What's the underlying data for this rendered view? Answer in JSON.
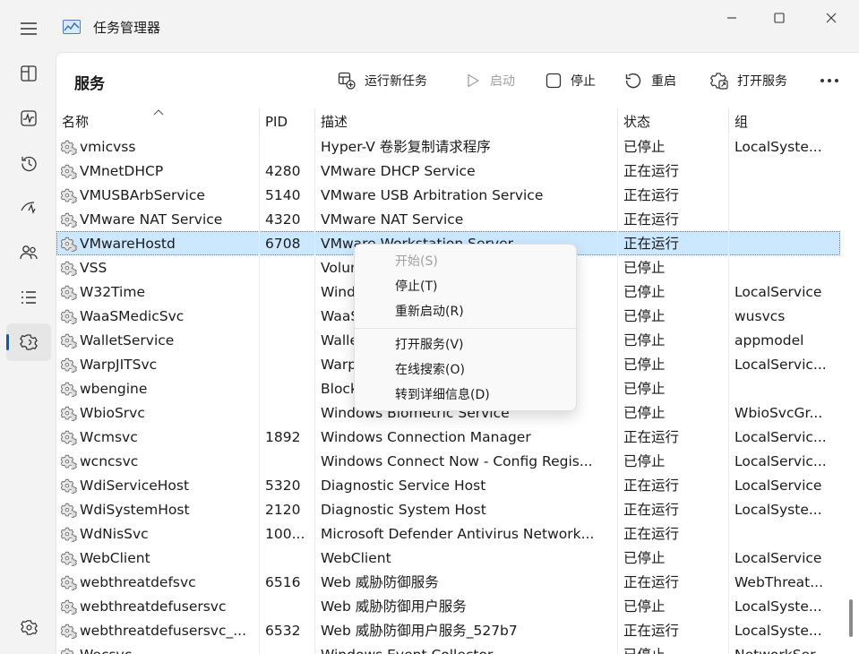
{
  "window": {
    "title": "任务管理器",
    "controls": [
      "minimize-icon",
      "maximize-icon",
      "close-icon"
    ]
  },
  "nav": {
    "items": [
      {
        "name": "processes",
        "icon": "processes-icon"
      },
      {
        "name": "performance",
        "icon": "performance-icon"
      },
      {
        "name": "app-history",
        "icon": "history-icon"
      },
      {
        "name": "startup-apps",
        "icon": "startup-icon"
      },
      {
        "name": "users",
        "icon": "users-icon"
      },
      {
        "name": "details",
        "icon": "details-icon"
      },
      {
        "name": "services",
        "icon": "services-icon",
        "active": true
      }
    ],
    "settings_icon": "gear-icon"
  },
  "page": {
    "title": "服务",
    "toolbar": {
      "run_new_task": "运行新任务",
      "start": "启动",
      "stop": "停止",
      "restart": "重启",
      "open_services": "打开服务",
      "more": "…"
    }
  },
  "table": {
    "headers": {
      "name": "名称",
      "pid": "PID",
      "desc": "描述",
      "status": "状态",
      "group": "组"
    },
    "sort_column": "name",
    "rows": [
      {
        "name": "vmicvss",
        "pid": "",
        "desc": "Hyper-V 卷影复制请求程序",
        "status": "已停止",
        "group": "LocalSyste..."
      },
      {
        "name": "VMnetDHCP",
        "pid": "4280",
        "desc": "VMware DHCP Service",
        "status": "正在运行",
        "group": ""
      },
      {
        "name": "VMUSBArbService",
        "pid": "5140",
        "desc": "VMware USB Arbitration Service",
        "status": "正在运行",
        "group": ""
      },
      {
        "name": "VMware NAT Service",
        "pid": "4320",
        "desc": "VMware NAT Service",
        "status": "正在运行",
        "group": ""
      },
      {
        "name": "VMwareHostd",
        "pid": "6708",
        "desc": "VMware Workstation Server",
        "status": "正在运行",
        "group": "",
        "selected": true
      },
      {
        "name": "VSS",
        "pid": "",
        "desc": "Volume Shadow Copy",
        "status": "已停止",
        "group": ""
      },
      {
        "name": "W32Time",
        "pid": "",
        "desc": "Windows Time",
        "status": "已停止",
        "group": "LocalService"
      },
      {
        "name": "WaaSMedicSvc",
        "pid": "",
        "desc": "WaaSMedicSvc",
        "status": "已停止",
        "group": "wusvcs"
      },
      {
        "name": "WalletService",
        "pid": "",
        "desc": "WalletService",
        "status": "已停止",
        "group": "appmodel"
      },
      {
        "name": "WarpJITSvc",
        "pid": "",
        "desc": "Warp JIT Service",
        "status": "已停止",
        "group": "LocalServic..."
      },
      {
        "name": "wbengine",
        "pid": "",
        "desc": "Block Level Backup Engine Service",
        "status": "已停止",
        "group": ""
      },
      {
        "name": "WbioSrvc",
        "pid": "",
        "desc": "Windows Biometric Service",
        "status": "已停止",
        "group": "WbioSvcGr..."
      },
      {
        "name": "Wcmsvc",
        "pid": "1892",
        "desc": "Windows Connection Manager",
        "status": "正在运行",
        "group": "LocalServic..."
      },
      {
        "name": "wcncsvc",
        "pid": "",
        "desc": "Windows Connect Now - Config Regis...",
        "status": "已停止",
        "group": "LocalServic..."
      },
      {
        "name": "WdiServiceHost",
        "pid": "5320",
        "desc": "Diagnostic Service Host",
        "status": "正在运行",
        "group": "LocalService"
      },
      {
        "name": "WdiSystemHost",
        "pid": "2120",
        "desc": "Diagnostic System Host",
        "status": "正在运行",
        "group": "LocalSyste..."
      },
      {
        "name": "WdNisSvc",
        "pid": "100...",
        "desc": "Microsoft Defender Antivirus Network...",
        "status": "正在运行",
        "group": ""
      },
      {
        "name": "WebClient",
        "pid": "",
        "desc": "WebClient",
        "status": "已停止",
        "group": "LocalService"
      },
      {
        "name": "webthreatdefsvc",
        "pid": "6516",
        "desc": "Web 威胁防御服务",
        "status": "正在运行",
        "group": "WebThreat..."
      },
      {
        "name": "webthreatdefusersvc",
        "pid": "",
        "desc": "Web 威胁防御用户服务",
        "status": "已停止",
        "group": "LocalSyste..."
      },
      {
        "name": "webthreatdefusersvc_...",
        "pid": "6532",
        "desc": "Web 威胁防御用户服务_527b7",
        "status": "正在运行",
        "group": "LocalSyste..."
      },
      {
        "name": "Wecsvc",
        "pid": "",
        "desc": "Windows Event Collector",
        "status": "已停止",
        "group": "NetworkSer..."
      }
    ]
  },
  "context_menu": {
    "items": [
      {
        "label": "开始(S)",
        "disabled": true
      },
      {
        "label": "停止(T)"
      },
      {
        "label": "重新启动(R)"
      },
      {
        "label": "打开服务(V)"
      },
      {
        "label": "在线搜索(O)"
      },
      {
        "label": "转到详细信息(D)"
      }
    ]
  }
}
